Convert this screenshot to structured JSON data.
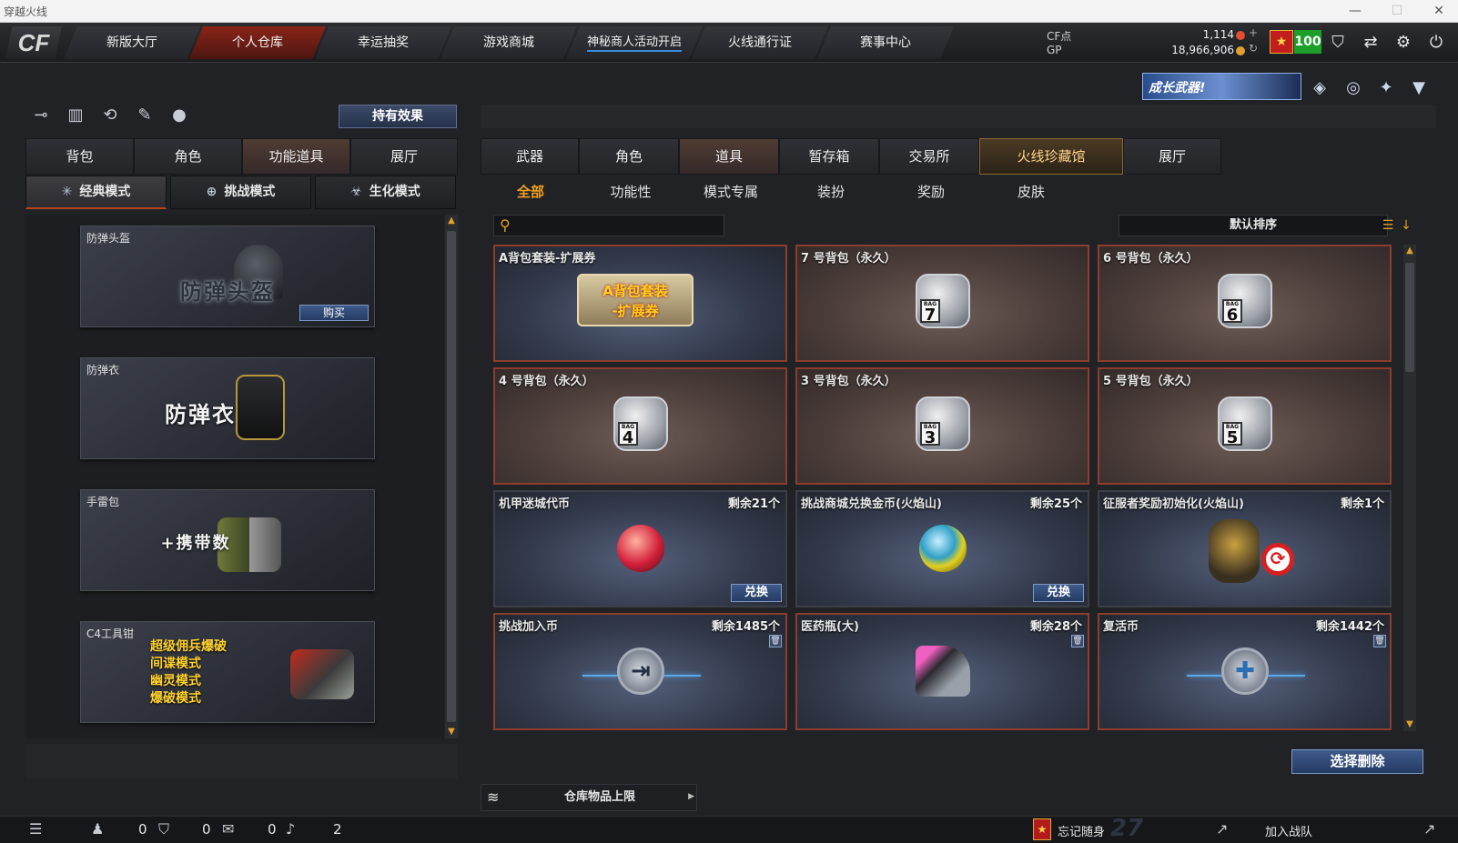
{
  "window": {
    "title": "穿越火线",
    "buttons": [
      "—",
      "☐",
      "✕"
    ]
  },
  "nav": {
    "logo": "CF",
    "tabs": [
      {
        "label": "新版大厅"
      },
      {
        "label": "个人仓库",
        "active": true
      },
      {
        "label": "幸运抽奖"
      },
      {
        "label": "游戏商城"
      },
      {
        "label": "神秘商人活动开启"
      },
      {
        "label": "火线通行证"
      },
      {
        "label": "赛事中心"
      }
    ]
  },
  "currency": {
    "cf_label": "CF点",
    "cf_value": "1,114",
    "gp_label": "GP",
    "gp_value": "18,966,906",
    "level": "100"
  },
  "top_icons": [
    "shield-icon",
    "swap-icon",
    "gear-icon",
    "power-icon"
  ],
  "banner": {
    "text": "成长武器!"
  },
  "left": {
    "effect_button": "持有效果",
    "tabs": [
      "背包",
      "角色",
      "功能道具",
      "展厅"
    ],
    "active_tab": 2,
    "modes": [
      "经典模式",
      "挑战模式",
      "生化模式"
    ],
    "cards": [
      {
        "caption": "防弹头盔",
        "title": "防弹头盔",
        "buy": "购买"
      },
      {
        "caption": "防弹衣",
        "title": "防弹衣"
      },
      {
        "caption": "手雷包",
        "title": "+携带数"
      },
      {
        "caption": "C4工具钳",
        "lines": [
          "超级佣兵爆破",
          "间谍模式",
          "幽灵模式",
          "爆破模式"
        ]
      }
    ]
  },
  "right": {
    "tabs": [
      "武器",
      "角色",
      "道具",
      "暂存箱",
      "交易所",
      "火线珍藏馆",
      "展厅"
    ],
    "active_tab": 2,
    "filters": [
      "全部",
      "功能性",
      "模式专属",
      "装扮",
      "奖励",
      "皮肤"
    ],
    "search_placeholder": "",
    "sort_label": "默认排序",
    "items": [
      {
        "name": "A背包套装-扩展券",
        "art": "A背包套装\n-扩展券"
      },
      {
        "name": "7 号背包（永久）",
        "bag": "7"
      },
      {
        "name": "6 号背包（永久）",
        "bag": "6"
      },
      {
        "name": "4 号背包（永久）",
        "bag": "4"
      },
      {
        "name": "3 号背包（永久）",
        "bag": "3"
      },
      {
        "name": "5 号背包（永久）",
        "bag": "5"
      },
      {
        "name": "机甲迷城代币",
        "remain": "剩余21个",
        "button": "兑换"
      },
      {
        "name": "挑战商城兑换金币(火焰山)",
        "remain": "剩余25个",
        "button": "兑换"
      },
      {
        "name": "征服者奖励初始化(火焰山)",
        "remain": "剩余1个"
      },
      {
        "name": "挑战加入币",
        "remain": "剩余1485个"
      },
      {
        "name": "医药瓶(大)",
        "remain": "剩余28个"
      },
      {
        "name": "复活币",
        "remain": "剩余1442个"
      }
    ],
    "delete_button": "选择删除",
    "storage_limit": "仓库物品上限"
  },
  "status": {
    "counts": [
      "0",
      "0",
      "0",
      "2"
    ],
    "random_label": "忘记随身",
    "season": "27",
    "join_label": "加入战队"
  }
}
